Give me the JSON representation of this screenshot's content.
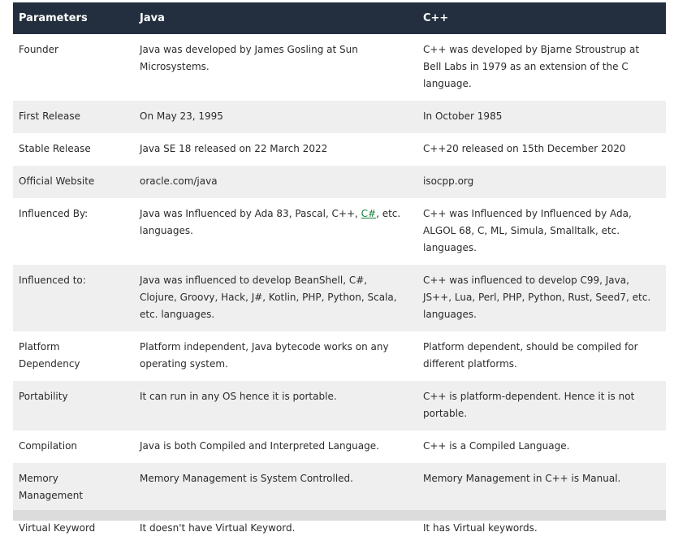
{
  "headers": [
    "Parameters",
    "Java",
    "C++"
  ],
  "rows": [
    {
      "param": "Founder",
      "java": "Java was developed by James Gosling at Sun Microsystems.",
      "cpp": "C++ was developed by Bjarne Stroustrup at Bell Labs in 1979 as an extension of the C language."
    },
    {
      "param": "First Release",
      "java": "On May 23, 1995",
      "cpp": "In October 1985"
    },
    {
      "param": "Stable Release",
      "java": "Java SE 18 released on 22 March 2022",
      "cpp": "C++20  released on 15th December 2020"
    },
    {
      "param": "Official Website",
      "java": "oracle.com/java",
      "cpp": "isocpp.org"
    },
    {
      "param": "Influenced By:",
      "java_before": "Java was Influenced by Ada 83, Pascal, C++, ",
      "java_link": "C#",
      "java_after": ", etc. languages.",
      "cpp": "C++ was Influenced by Influenced by Ada, ALGOL 68, C, ML, Simula, Smalltalk, etc. languages."
    },
    {
      "param": "Influenced to:",
      "java": "Java was influenced to develop BeanShell, C#, Clojure, Groovy, Hack, J#, Kotlin, PHP, Python, Scala, etc. languages.",
      "cpp": "C++ was influenced to develop C99, Java, JS++, Lua, Perl, PHP, Python, Rust, Seed7, etc. languages."
    },
    {
      "param": "Platform Dependency",
      "java": "Platform independent, Java bytecode works on any operating system.",
      "cpp": "Platform dependent, should be compiled for different platforms."
    },
    {
      "param": "Portability",
      "java": "It can run in any OS hence it is portable.",
      "cpp": "C++ is platform-dependent. Hence it is not portable."
    },
    {
      "param": "Compilation",
      "java": "Java is both Compiled and Interpreted Language.",
      "cpp": "C++ is a Compiled Language."
    },
    {
      "param": "Memory Management",
      "java": "Memory Management is System Controlled.",
      "cpp": "Memory Management in C++ is Manual."
    },
    {
      "param": "Virtual Keyword",
      "java": "It doesn't have Virtual Keyword.",
      "cpp": "It has Virtual keywords."
    }
  ],
  "colors": {
    "header_bg": "#232f3e",
    "header_text": "#ffffff",
    "row_alt_bg": "#efefef",
    "link": "#1a7f3c"
  }
}
